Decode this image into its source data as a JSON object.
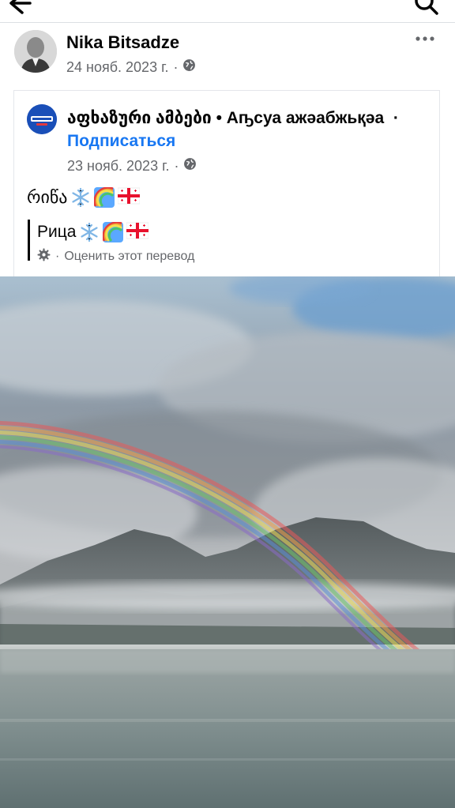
{
  "post": {
    "author_name": "Nika Bitsadze",
    "date": "24 нояб. 2023 г.",
    "separator": "·",
    "privacy_icon": "globe-icon",
    "more_icon": "more-dots-icon"
  },
  "shared": {
    "page_name": "აფხაზური ამბები • Аҧсуа ажәабжьқәа",
    "separator": "·",
    "follow_label": "Подписаться",
    "date": "23 нояб. 2023 г.",
    "privacy_icon": "globe-icon",
    "original_text": "რიწა",
    "translated_text": "Рица",
    "emojis": [
      "snowflake",
      "rainbow",
      "georgian-flag"
    ],
    "rate_label": "Оценить этот перевод",
    "rate_icon": "gear-icon"
  },
  "nav": {
    "back_icon": "back-arrow-icon",
    "search_icon": "search-icon"
  },
  "colors": {
    "link": "#1877f2",
    "meta": "#65676b",
    "text": "#050505"
  }
}
